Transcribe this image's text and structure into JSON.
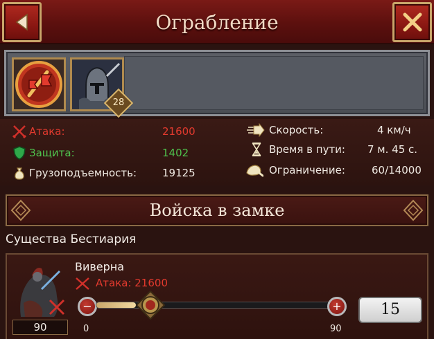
{
  "header": {
    "title": "Ограбление",
    "back_icon": "arrow-left-icon",
    "close_icon": "close-x-icon"
  },
  "selected_units": {
    "slots": [
      {
        "icon": "red-banner-sword-icon"
      },
      {
        "icon": "knight-portrait-icon",
        "level": "28"
      }
    ]
  },
  "stats": {
    "attack": {
      "label": "Атака:",
      "value": "21600"
    },
    "defense": {
      "label": "Защита:",
      "value": "1402"
    },
    "capacity": {
      "label": "Грузоподъемность:",
      "value": "19125"
    },
    "speed": {
      "label": "Скорость:",
      "value": "4 км/ч"
    },
    "travel_time": {
      "label": "Время в пути:",
      "value": "7 м. 45 с."
    },
    "limit": {
      "label": "Ограничение:",
      "value": "60/14000"
    }
  },
  "section": {
    "title": "Войска в замке",
    "subtitle": "Существа Бестиария"
  },
  "unit": {
    "name": "Виверна",
    "attack_text": "Атака: 21600",
    "count": "90",
    "slider": {
      "min": "0",
      "max": "90",
      "value": 15,
      "fraction": 0.167
    },
    "quantity": "15"
  },
  "colors": {
    "header_red": "#7a1a16",
    "gold_border": "#c9a66a",
    "attack_red": "#e23a2e",
    "defense_green": "#4fc24d"
  }
}
